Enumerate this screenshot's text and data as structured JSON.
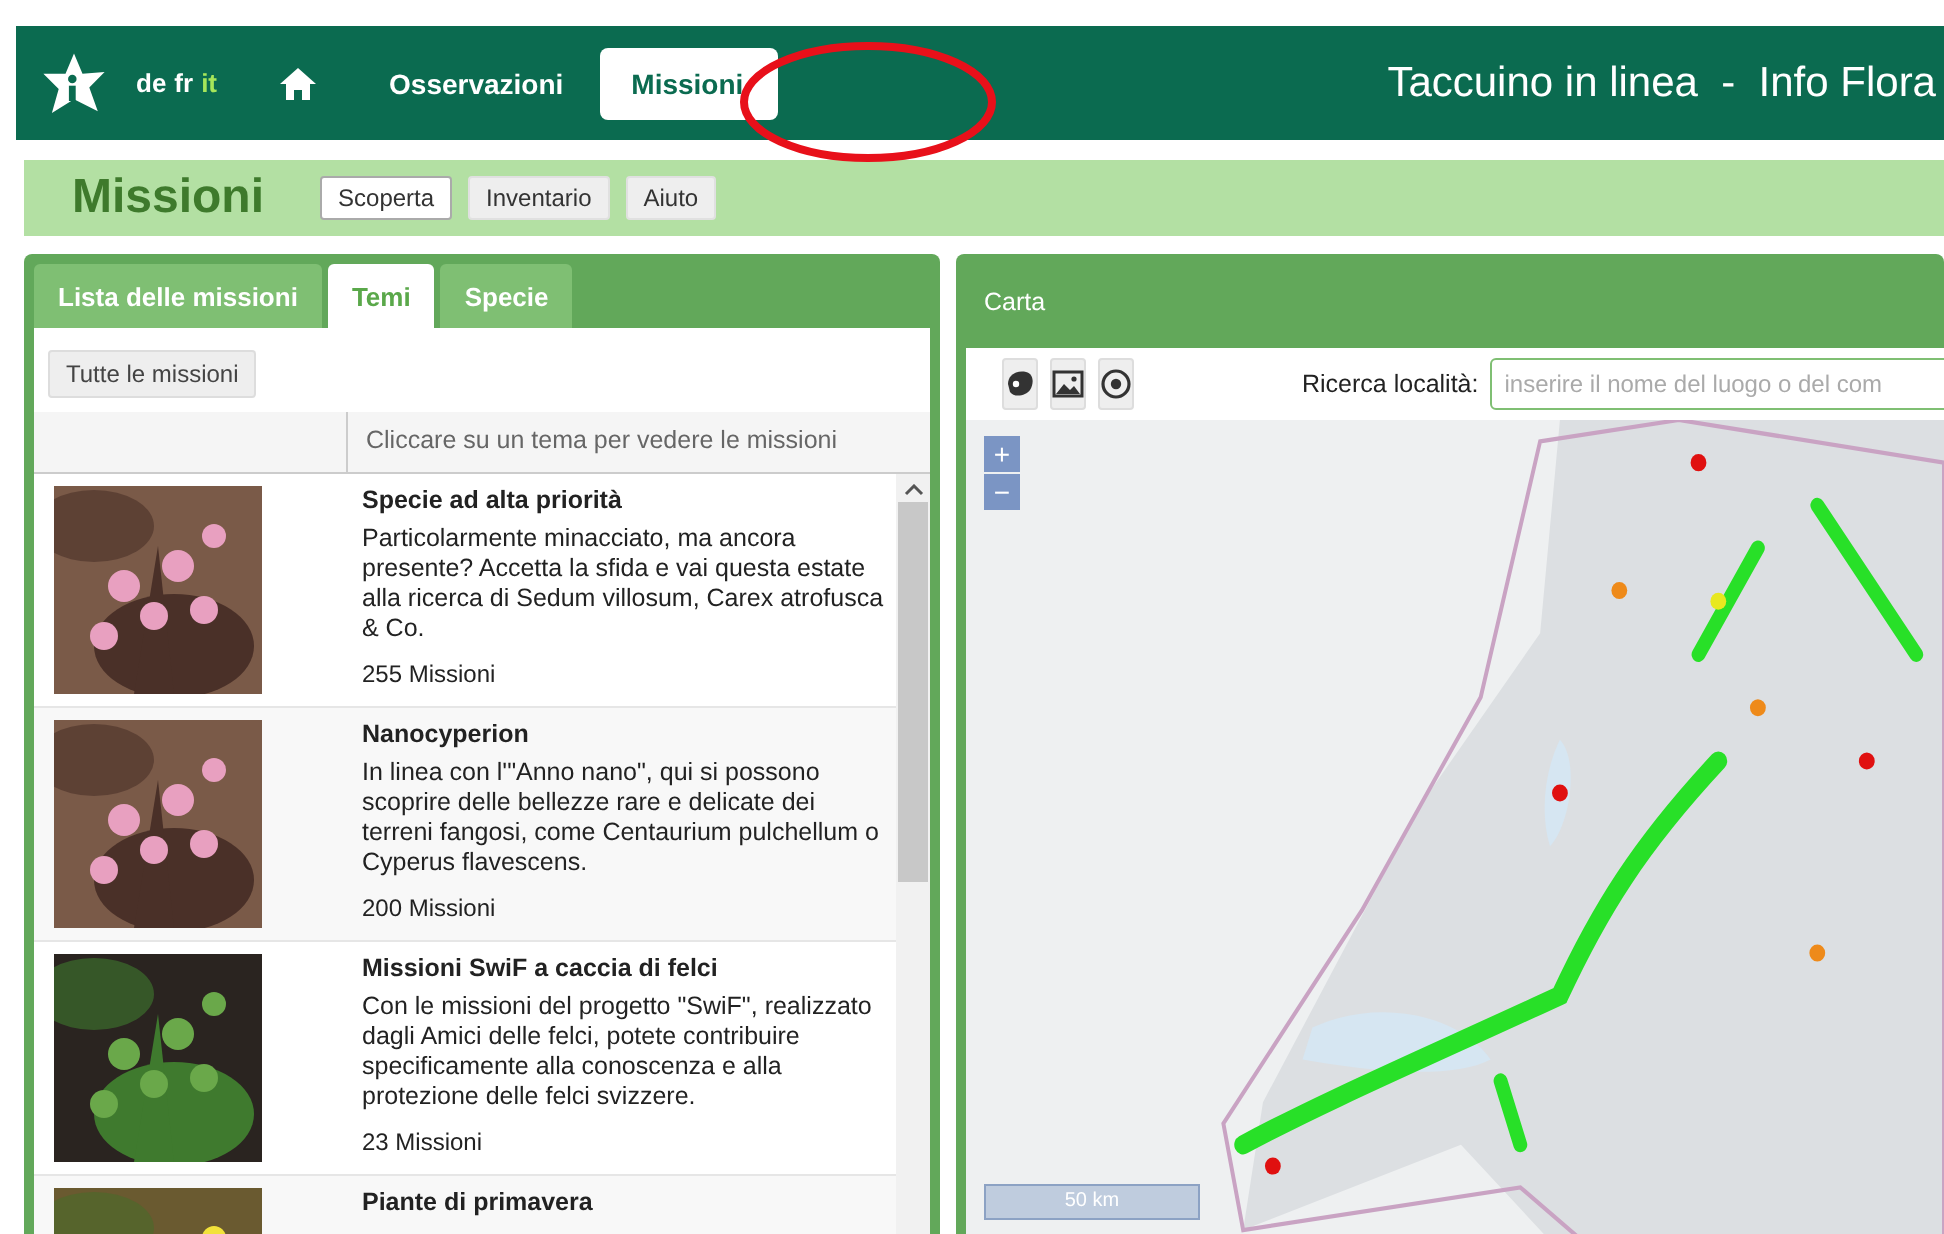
{
  "header": {
    "languages": [
      {
        "label": "de",
        "selected": false
      },
      {
        "label": "fr",
        "selected": false
      },
      {
        "label": "it",
        "selected": true
      }
    ],
    "nav": [
      {
        "kind": "home"
      },
      {
        "kind": "text",
        "label": "Osservazioni",
        "selected": false
      },
      {
        "kind": "text",
        "label": "Missioni",
        "selected": true
      }
    ],
    "title": "Taccuino in linea  -  Info Flora"
  },
  "annotation": {
    "kind": "ellipse"
  },
  "page": {
    "title": "Missioni",
    "tabs": [
      {
        "label": "Scoperta",
        "selected": true
      },
      {
        "label": "Inventario",
        "selected": false
      },
      {
        "label": "Aiuto",
        "selected": false
      }
    ]
  },
  "left_panel": {
    "tabs": [
      {
        "label": "Lista delle missioni",
        "selected": false
      },
      {
        "label": "Temi",
        "selected": true
      },
      {
        "label": "Specie",
        "selected": false
      }
    ],
    "all_button": "Tutte le missioni",
    "column_header": "Cliccare su un tema per vedere le missioni",
    "themes": [
      {
        "kind": "pink-flowers",
        "title": "Specie ad alta priorità",
        "description": "Particolarmente minacciato, ma ancora presente? Accetta la sfida e vai questa estate alla ricerca di Sedum villosum, Carex atrofusca & Co.",
        "count": "255 Missioni"
      },
      {
        "kind": "pink-flowers",
        "title": "Nanocyperion",
        "description": "In linea con l'\"Anno nano\", qui si possono scoprire delle bellezze rare e delicate dei terreni fangosi, come Centaurium pulchellum o Cyperus flavescens.",
        "count": "200 Missioni"
      },
      {
        "kind": "fern",
        "title": "Missioni SwiF a caccia di felci",
        "description": "Con le missioni del progetto \"SwiF\", realizzato dagli Amici delle felci, potete contribuire specificamente alla conoscenza e alla protezione delle felci svizzere.",
        "count": "23 Missioni"
      },
      {
        "kind": "yellow-flowers",
        "title": "Piante di primavera"
      }
    ]
  },
  "map_panel": {
    "title": "Carta",
    "search": {
      "label": "Ricerca località:",
      "placeholder": "inserire il nome del luogo o del com"
    },
    "zoom": [
      "+",
      "−"
    ],
    "scale": "50 km"
  }
}
